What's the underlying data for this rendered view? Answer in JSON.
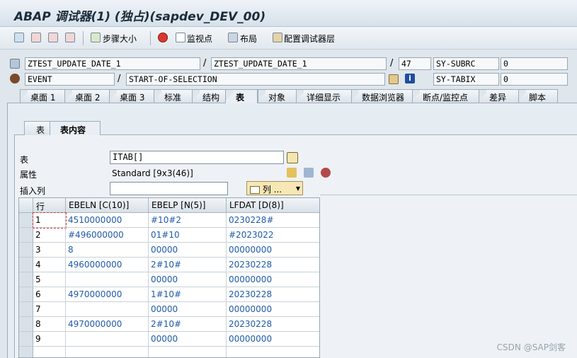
{
  "title": "ABAP 调试器(1) (独占)(sapdev_DEV_00)",
  "toolbar": {
    "step_size": "步骤大小",
    "watchpoint": "监视点",
    "layout": "布局",
    "configure": "配置调试器层"
  },
  "info": {
    "program1": "ZTEST_UPDATE_DATE_1",
    "program2": "ZTEST_UPDATE_DATE_1",
    "line": "47",
    "subrc_label": "SY-SUBRC",
    "subrc_value": "0",
    "event_type": "EVENT",
    "event_name": "START-OF-SELECTION",
    "tabix_label": "SY-TABIX",
    "tabix_value": "0"
  },
  "tabs": [
    "桌面 1",
    "桌面 2",
    "桌面 3",
    "标准",
    "结构",
    "表",
    "对象",
    "详细显示",
    "数据浏览器",
    "断点/监控点",
    "差异",
    "脚本"
  ],
  "subtabs": [
    "表",
    "表内容"
  ],
  "form": {
    "table_label": "表",
    "table_value": "ITAB[]",
    "attr_label": "属性",
    "attr_value": "Standard [9x3(46)]",
    "insert_col_label": "插入列",
    "insert_col_value": "",
    "columns_button": "列 ..."
  },
  "grid": {
    "headers": [
      "行",
      "EBELN [C(10)]",
      "EBELP [N(5)]",
      "LFDAT [D(8)]"
    ],
    "rows": [
      [
        "1",
        "4510000000",
        "#10#2",
        "0230228#"
      ],
      [
        "2",
        "#496000000",
        "01#10",
        "#2023022"
      ],
      [
        "3",
        "8",
        "00000",
        "00000000"
      ],
      [
        "4",
        "4960000000",
        "2#10#",
        "20230228"
      ],
      [
        "5",
        "",
        "00000",
        "00000000"
      ],
      [
        "6",
        "4970000000",
        "1#10#",
        "20230228"
      ],
      [
        "7",
        "",
        "00000",
        "00000000"
      ],
      [
        "8",
        "4970000000",
        "2#10#",
        "20230228"
      ],
      [
        "9",
        "",
        "00000",
        "00000000"
      ]
    ]
  },
  "watermark": "CSDN @SAP剑客"
}
